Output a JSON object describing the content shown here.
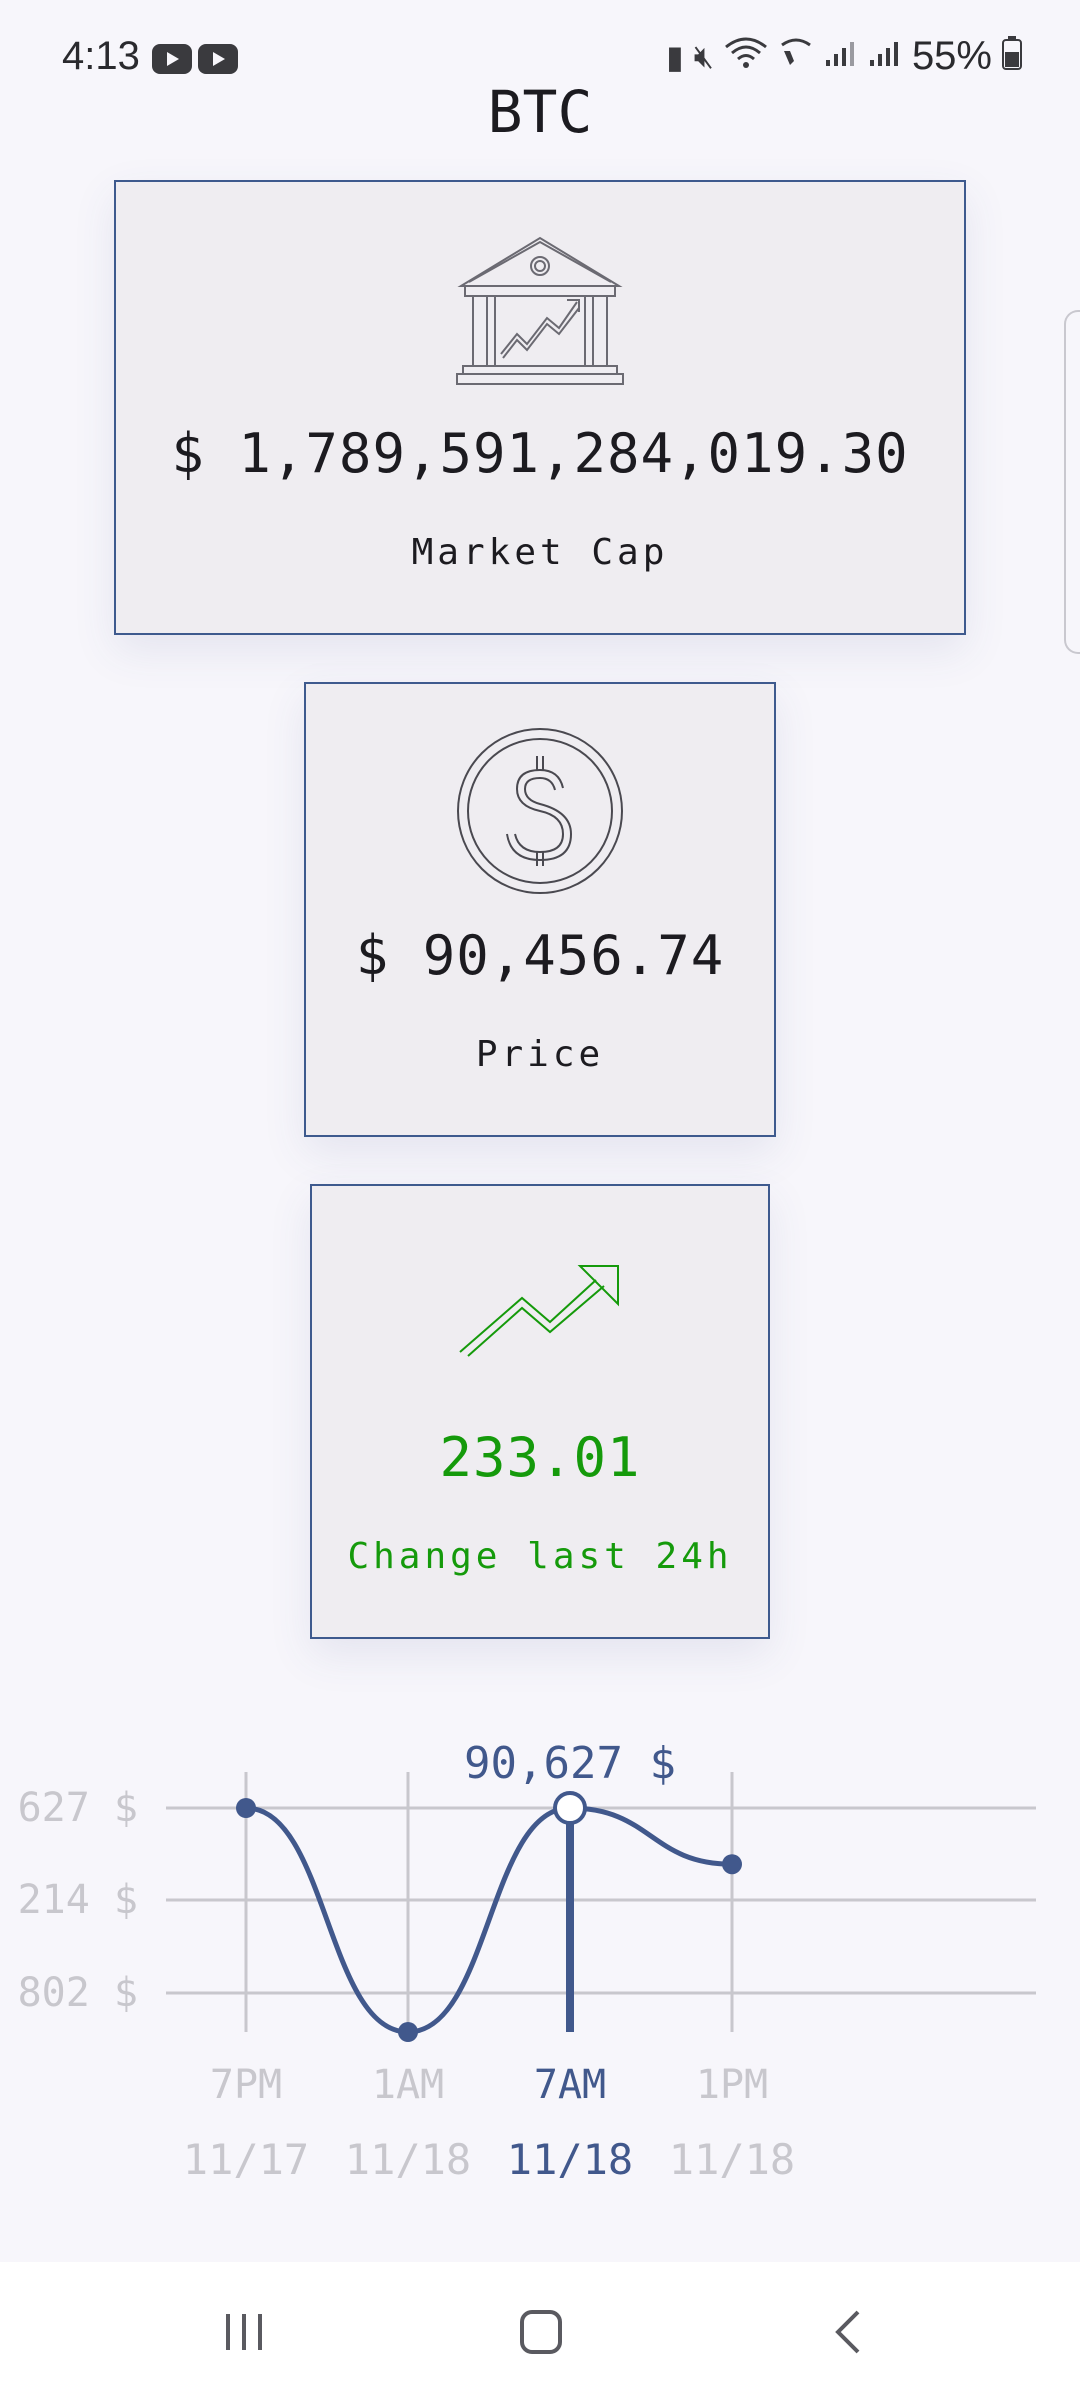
{
  "status_bar": {
    "time": "4:13",
    "battery": "55%"
  },
  "title": "BTC",
  "market_cap": {
    "value": "$ 1,789,591,284,019.30",
    "label": "Market Cap",
    "icon": "bank-chart-icon"
  },
  "price": {
    "value": "$ 90,456.74",
    "label": "Price",
    "icon": "dollar-coin-icon"
  },
  "change": {
    "value": "233.01",
    "label": "Change last 24h",
    "icon": "trending-up-icon",
    "color": "#159a0b"
  },
  "chart_data": {
    "type": "line",
    "selected_label": "90,627 $",
    "y_tick_labels": [
      "627 $",
      "214 $",
      "802 $"
    ],
    "x": [
      {
        "time": "7PM",
        "date": "11/17"
      },
      {
        "time": "1AM",
        "date": "11/18"
      },
      {
        "time": "7AM",
        "date": "11/18"
      },
      {
        "time": "1PM",
        "date": "11/18"
      }
    ],
    "values": [
      90627,
      89802,
      90627,
      90420
    ],
    "selected_index": 2,
    "line_color": "#41588c",
    "grid": true
  }
}
